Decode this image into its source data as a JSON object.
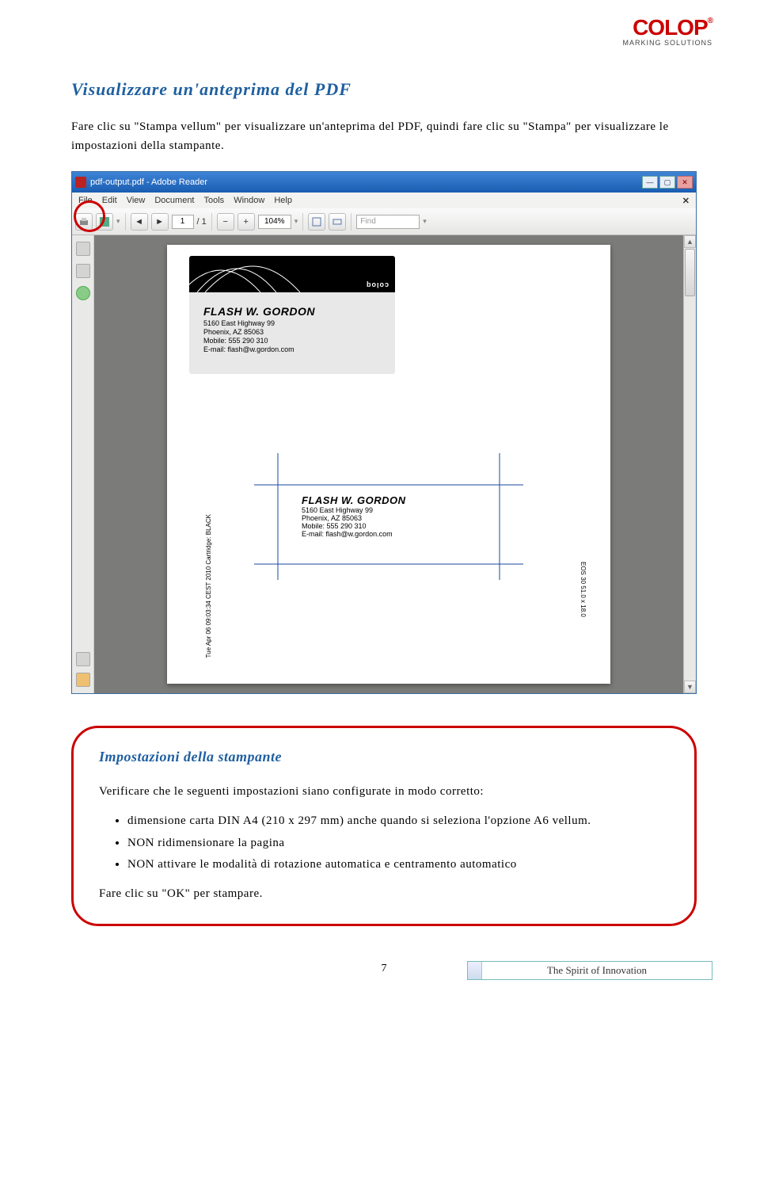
{
  "logo": {
    "brand": "COLOP",
    "reg": "®",
    "tagline": "MARKING SOLUTIONS"
  },
  "heading": "Visualizzare un'anteprima del PDF",
  "intro": "Fare clic su \"Stampa vellum\" per visualizzare un'anteprima del PDF, quindi fare clic su \"Stampa\" per visualizzare le impostazioni della stampante.",
  "ar": {
    "title": "pdf-output.pdf - Adobe Reader",
    "menu": [
      "File",
      "Edit",
      "View",
      "Document",
      "Tools",
      "Window",
      "Help"
    ],
    "page_current": "1",
    "page_total": "/ 1",
    "zoom": "104%",
    "find": "Find"
  },
  "imprint": {
    "brand_upside": "coloq",
    "name": "FLASH W. GORDON",
    "lines": [
      "5160 East Highway 99",
      "Phoenix, AZ 85063",
      "Mobile: 555 290 310",
      "E-mail: flash@w.gordon.com"
    ]
  },
  "vtext_left": "Tue Apr 06 09:03:34 CEST 2010    Cartridge: BLACK",
  "vtext_right": "EOS 30   51.0 x 18.0",
  "callout": {
    "heading": "Impostazioni della stampante",
    "p1": "Verificare che le seguenti impostazioni siano configurate in modo corretto:",
    "bullets": [
      "dimensione carta DIN A4 (210 x 297 mm) anche quando si seleziona l'opzione A6 vellum.",
      "NON ridimensionare la pagina",
      "NON attivare le modalità di rotazione automatica e centramento automatico"
    ],
    "p2": "Fare clic su \"OK\" per stampare."
  },
  "page_number": "7",
  "footer_slogan": "The Spirit of Innovation"
}
